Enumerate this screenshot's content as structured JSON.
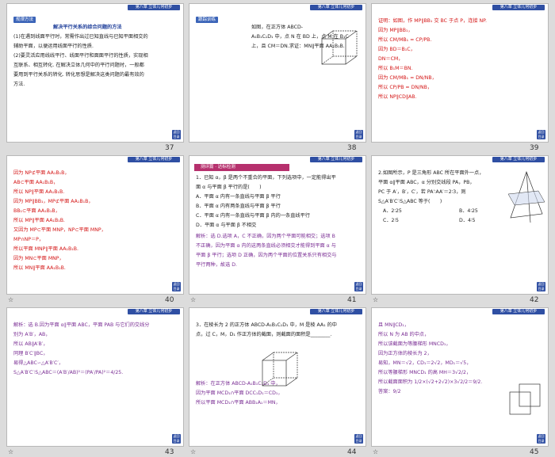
{
  "header_chip": "第八章 立体几何初步",
  "slides": [
    {
      "num": "37",
      "tag": "规律方法",
      "title": "解决平行关系的综合问题的方法",
      "lines": [
        "(1)在遇到线面平行时，常需作出过已知直线与已知平面相交的",
        "辅助平面，以便运用线面平行的性质.",
        "(2)要灵活应用线线平行、线面平行和面面平行的性质，实现相",
        "互联系、相互转化. 在解决立体几何中的平行问题时，一般都",
        "要用到平行关系的转化. 转化思想是解决这类问题的最有效的",
        "方法."
      ]
    },
    {
      "num": "38",
      "tag": "跟踪训练",
      "lines": [
        "如图，在正方体 ABCD-",
        "A₁B₁C₁D₁ 中，点 N 在 BD 上，点 M 在 B₁C",
        "上，且 CM＝DN.求证：MN∥平面 AA₁B₁B."
      ]
    },
    {
      "num": "39",
      "lines": [
        "证明：如图，作 MP∥BB₁ 交 BC 于点 P，连接 NP.",
        "因为 MP∥BB₁，",
        "所以 CM/MB₁ = CP/PB.",
        "因为 BD＝B₁C，",
        "DN＝CM，",
        "所以 B₁M＝BN.",
        "因为 CM/MB₁ = DN/NB，",
        "所以 CP/PB = DN/NB，",
        "所以 NP∥CD∥AB."
      ]
    },
    {
      "num": "40",
      "lines": [
        "因为 NP⊄平面 AA₁B₁B，",
        "AB⊂平面 AA₁B₁B，",
        "所以 NP∥平面 AA₁B₁B.",
        "因为 MP∥BB₁，MP⊄平面 AA₁B₁B，",
        "BB₁⊂平面 AA₁B₁B，",
        "所以 MP∥平面 AA₁B₁B.",
        "又因为 MP⊂平面 MNP，NP⊂平面 MNP，",
        "MP∩NP＝P，",
        "所以平面 MNP∥平面 AA₁B₁B.",
        "因为 MN⊂平面 MNP，",
        "所以 MN∥平面 AA₁B₁B."
      ]
    },
    {
      "num": "41",
      "tag": "测评篇 · 达标检测",
      "lines": [
        "1．已知 α，β 是两个不重合的平面，下列选项中，一定能得出平",
        "面 α 与平面 β 平行的是(　　)",
        "A．平面 α 内有一条直线与平面 β 平行",
        "B．平面 α 内有两条直线与平面 β 平行",
        "C．平面 α 内有一条直线与平面 β 内的一条直线平行",
        "D．平面 α 与平面 β 不相交"
      ],
      "answer": [
        "解析：选 D.选项 A，C 不正确，因为两个平面可能相交；选项 B",
        "不正确，因为平面 α 内的这两条直线必须相交才能得到平面 α 与",
        "平面 β 平行；选项 D 正确，因为两个平面的位置关系只有相交与",
        "平行两种，故选 D."
      ]
    },
    {
      "num": "42",
      "lines": [
        "2.如图所示，P 是三角形 ABC 所在平面外一点，",
        "平面 α∥平面 ABC，α 分别交线段 PA，PB，",
        "PC 于 A′，B′，C′，若 PA′∶AA′＝2∶3，则",
        "S△A′B′C′∶S△ABC 等于(　　)",
        "A．2∶25",
        "B．4∶25",
        "C．2∶5",
        "D．4∶5"
      ]
    },
    {
      "num": "43",
      "lines": [
        "解析：选 B.因为平面 α∥平面 ABC，平面 PAB 与它们的交线分",
        "别为 A′B′，AB，",
        "所以 AB∥A′B′，",
        "同理 B′C′∥BC，",
        "易得△ABC∽△A′B′C′，",
        "S△A′B′C′∶S△ABC＝(A′B′/AB)²＝(PA′/PA)²＝4/25."
      ]
    },
    {
      "num": "44",
      "lines": [
        "3．在棱长为 2 的正方体 ABCD-A₁B₁C₁D₁ 中，M 是棱 AA₁ 的中",
        "点，过 C，M，D₁ 作正方体的截面，则截面的面积是________."
      ],
      "answer": [
        "解析：在正方体 ABCD-A₁B₁C₁D₁ 中，",
        "因为平面 MCD₁∩平面 DCC₁D₁＝CD₁，",
        "所以平面 MCD₁∩平面 ABB₁A₁＝MN，"
      ]
    },
    {
      "num": "45",
      "lines": [
        "且 MN∥CD₁，",
        "所以 N 为 AB 的中点，",
        "所以该截面为等腰梯形 MNCD₁，",
        "因为正方体的棱长为 2，",
        "易知，MN＝√2，CD₁＝2√2，MD₁＝√5，",
        "所以等腰梯形 MNCD₁ 的高 MH＝3√2/2，",
        "所以截面面积为 1/2×(√2+2√2)×3√2/2＝9/2.",
        "答案：9/2"
      ]
    }
  ]
}
